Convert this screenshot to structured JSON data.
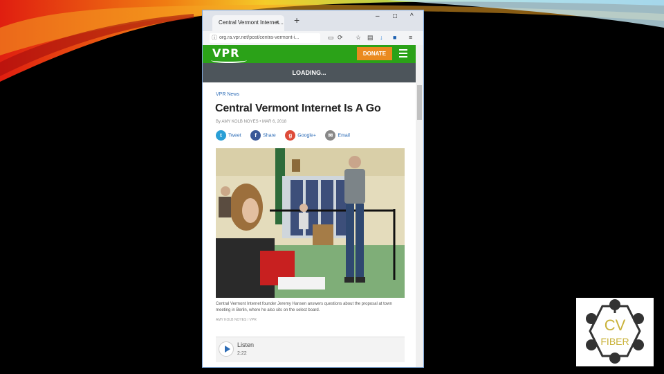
{
  "browser": {
    "tab_title": "Central Vermont Internet...",
    "tab_close": "×",
    "new_tab": "+",
    "win_min": "–",
    "win_max": "□",
    "win_close": "^",
    "url": "org.ra.vpr.net/post/centra-vermont-i...",
    "url_info_icon": "info-icon"
  },
  "site": {
    "logo": "VPR",
    "donate_label": "DONATE",
    "loading": "LOADING...",
    "section": "VPR News",
    "headline": "Central Vermont Internet Is A Go",
    "byline": "By AMY KOLB NOYES  •  MAR 6, 2018",
    "share": [
      {
        "label": "Tweet",
        "icon": "twitter-icon",
        "glyph": "t",
        "color": "#2a9fd6"
      },
      {
        "label": "Share",
        "icon": "facebook-icon",
        "glyph": "f",
        "color": "#3b5998"
      },
      {
        "label": "Google+",
        "icon": "google-plus-icon",
        "glyph": "g",
        "color": "#dd4b39"
      },
      {
        "label": "Email",
        "icon": "email-icon",
        "glyph": "✉",
        "color": "#888888"
      }
    ],
    "caption": "Central Vermont Internet founder Jeremy Hansen answers questions about the proposal at town meeting in Berlin, where he also sits on the select board.",
    "credit": "AMY KOLB NOYES / VPR",
    "player": {
      "label": "Listen",
      "duration": "2:22"
    }
  },
  "cvfiber": {
    "line1": "CV",
    "line2": "FIBER"
  },
  "colors": {
    "vpr_green": "#2ba218",
    "donate_orange": "#ea8a1f",
    "loading_bar": "#4d555b",
    "link_blue": "#2d6cb6"
  }
}
